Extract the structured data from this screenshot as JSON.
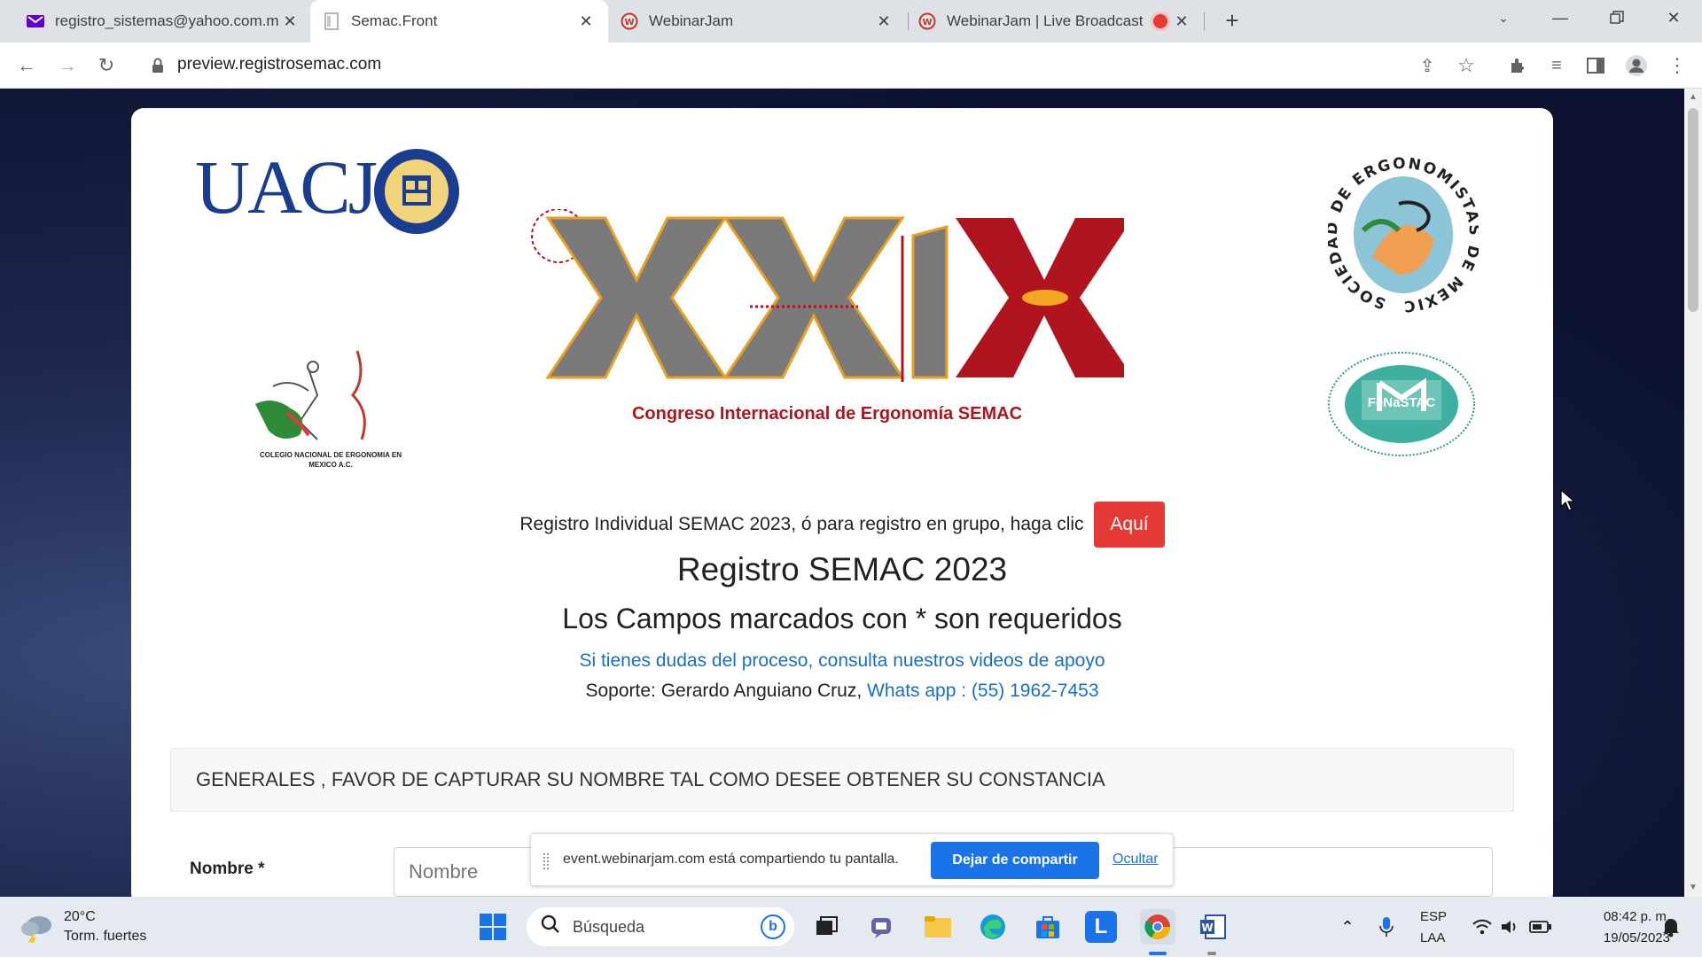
{
  "tabs": [
    {
      "title": "registro_sistemas@yahoo.com.m",
      "icon": "mail-icon"
    },
    {
      "title": "Semac.Front",
      "icon": "page-icon"
    },
    {
      "title": "WebinarJam",
      "icon": "webinarjam-icon"
    },
    {
      "title": "WebinarJam | Live Broadcast",
      "icon": "webinarjam-icon"
    }
  ],
  "address_bar": {
    "url": "preview.registrosemac.com"
  },
  "logos": {
    "uacj": "UACJ",
    "congress_numeral": "XXIX",
    "congress_title": "Congreso Internacional de Ergonomía SEMAC",
    "colegio": "COLEGIO NACIONAL DE ERGONOMIA EN MEXICO A.C.",
    "sociedad": "SOCIEDAD DE ERGONOMISTAS DE MEXICO A.C.",
    "fenastac": "FeNaSTAC"
  },
  "page": {
    "intro": "Registro Individual SEMAC 2023, ó para registro en grupo, haga clic",
    "aqui_button": "Aquí",
    "heading": "Registro SEMAC 2023",
    "required_note": "Los Campos marcados con * son requeridos",
    "help_link": "Si tienes dudas del proceso, consulta nuestros videos de apoyo",
    "support_prefix": "Soporte: Gerardo Anguiano Cruz,",
    "whatsapp_link": "Whats app : (55) 1962-7453",
    "section_title": "GENERALES , FAVOR DE CAPTURAR SU NOMBRE TAL COMO DESEE OBTENER SU CONSTANCIA",
    "nombre_label": "Nombre *",
    "nombre_placeholder": "Nombre"
  },
  "share_bar": {
    "message": "event.webinarjam.com está compartiendo tu pantalla.",
    "stop_label": "Dejar de compartir",
    "hide_label": "Ocultar"
  },
  "taskbar": {
    "weather_temp": "20°C",
    "weather_desc": "Torm. fuertes",
    "search_placeholder": "Búsqueda",
    "lang_top": "ESP",
    "lang_bottom": "LAA",
    "time": "08:42 p. m.",
    "date": "19/05/2023"
  },
  "colors": {
    "accent_red": "#e53935",
    "link_blue": "#1a6fc4",
    "uacj_blue": "#1b3d8f",
    "xxix_gray": "#7a7a7a",
    "xxix_red": "#b0141f"
  }
}
